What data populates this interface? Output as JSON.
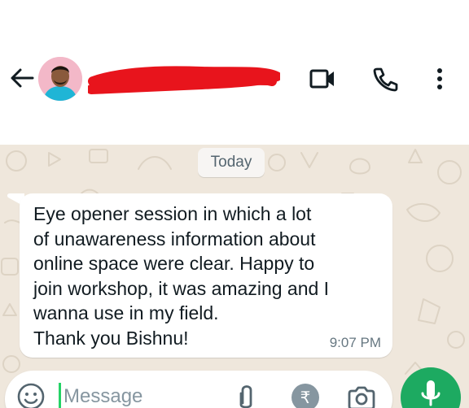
{
  "header": {
    "back_icon": "arrow-left-icon",
    "contact_name": "",
    "name_redacted": true,
    "redaction_color": "#e8141c",
    "video_call_icon": "video-camera-icon",
    "voice_call_icon": "phone-icon",
    "menu_icon": "more-vertical-icon"
  },
  "chat": {
    "wallpaper_color": "#efe7dc",
    "date_label": "Today",
    "messages": [
      {
        "direction": "incoming",
        "text": "Eye opener session in which a lot\nof unawareness information about\nonline space were clear. Happy to\njoin workshop, it was amazing and I\nwanna use in my field.\nThank you Bishnu!",
        "time": "9:07 PM"
      }
    ]
  },
  "composer": {
    "emoji_icon": "smiley-icon",
    "placeholder": "Message",
    "attach_icon": "paperclip-icon",
    "payment_icon": "rupee-icon",
    "payment_symbol": "₹",
    "camera_icon": "camera-icon",
    "mic_icon": "microphone-icon",
    "accent_color": "#1daa61"
  }
}
